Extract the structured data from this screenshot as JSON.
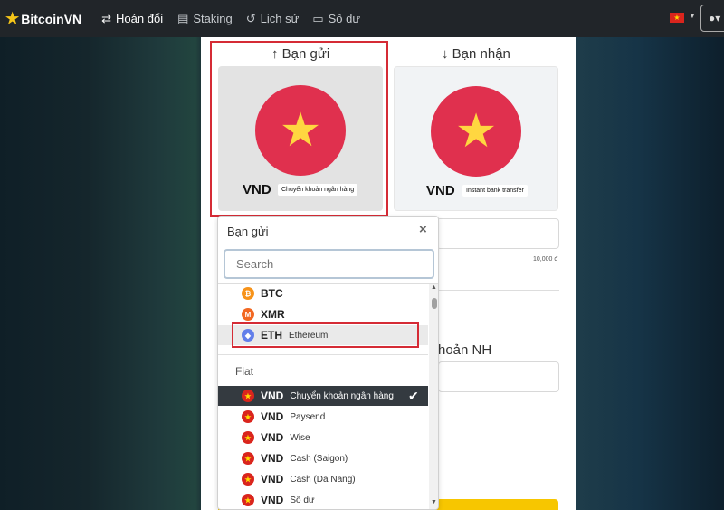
{
  "nav": {
    "brand": "BitcoinVN",
    "items": [
      {
        "label": "Hoán đổi",
        "icon": "swap-icon",
        "glyph": "⇄"
      },
      {
        "label": "Staking",
        "icon": "coins-icon",
        "glyph": "▤"
      },
      {
        "label": "Lịch sử",
        "icon": "history-icon",
        "glyph": "↺"
      },
      {
        "label": "Số dư",
        "icon": "wallet-icon",
        "glyph": "▭"
      }
    ],
    "user_glyph": "●▾"
  },
  "exchange": {
    "send_label": "↑ Bạn gửi",
    "receive_label": "↓ Bạn nhận",
    "send_card": {
      "currency": "VND",
      "method": "Chuyển khoản ngân hàng"
    },
    "receive_card": {
      "currency": "VND",
      "method": "Instant bank transfer"
    },
    "min_amount": "10,000 đ",
    "account_label": "hoản NH"
  },
  "dropdown": {
    "title": "Bạn gửi",
    "close": "×",
    "search_placeholder": "Search",
    "crypto_options": [
      {
        "code": "BTC",
        "desc": "",
        "icon": "btc-icon",
        "color": "#f7931a",
        "glyph": "₿"
      },
      {
        "code": "XMR",
        "desc": "",
        "icon": "monero-icon",
        "color": "#f26822",
        "glyph": "M"
      },
      {
        "code": "ETH",
        "desc": "Ethereum",
        "icon": "ethereum-icon",
        "color": "#627eea",
        "glyph": "◆"
      }
    ],
    "fiat_group_label": "Fiat",
    "fiat_options": [
      {
        "code": "VND",
        "desc": "Chuyển khoản ngân hàng"
      },
      {
        "code": "VND",
        "desc": "Paysend"
      },
      {
        "code": "VND",
        "desc": "Wise"
      },
      {
        "code": "VND",
        "desc": "Cash (Saigon)"
      },
      {
        "code": "VND",
        "desc": "Cash (Da Nang)"
      },
      {
        "code": "VND",
        "desc": "Số dư"
      }
    ],
    "selected_check": "✔"
  },
  "colors": {
    "vn_flag_red": "#e0304e",
    "vn_flag_star": "#ffd740",
    "highlight_red": "#d52b35",
    "navbar": "#212529",
    "selected_bg": "#343a40",
    "submit_yellow": "#f7c600"
  }
}
